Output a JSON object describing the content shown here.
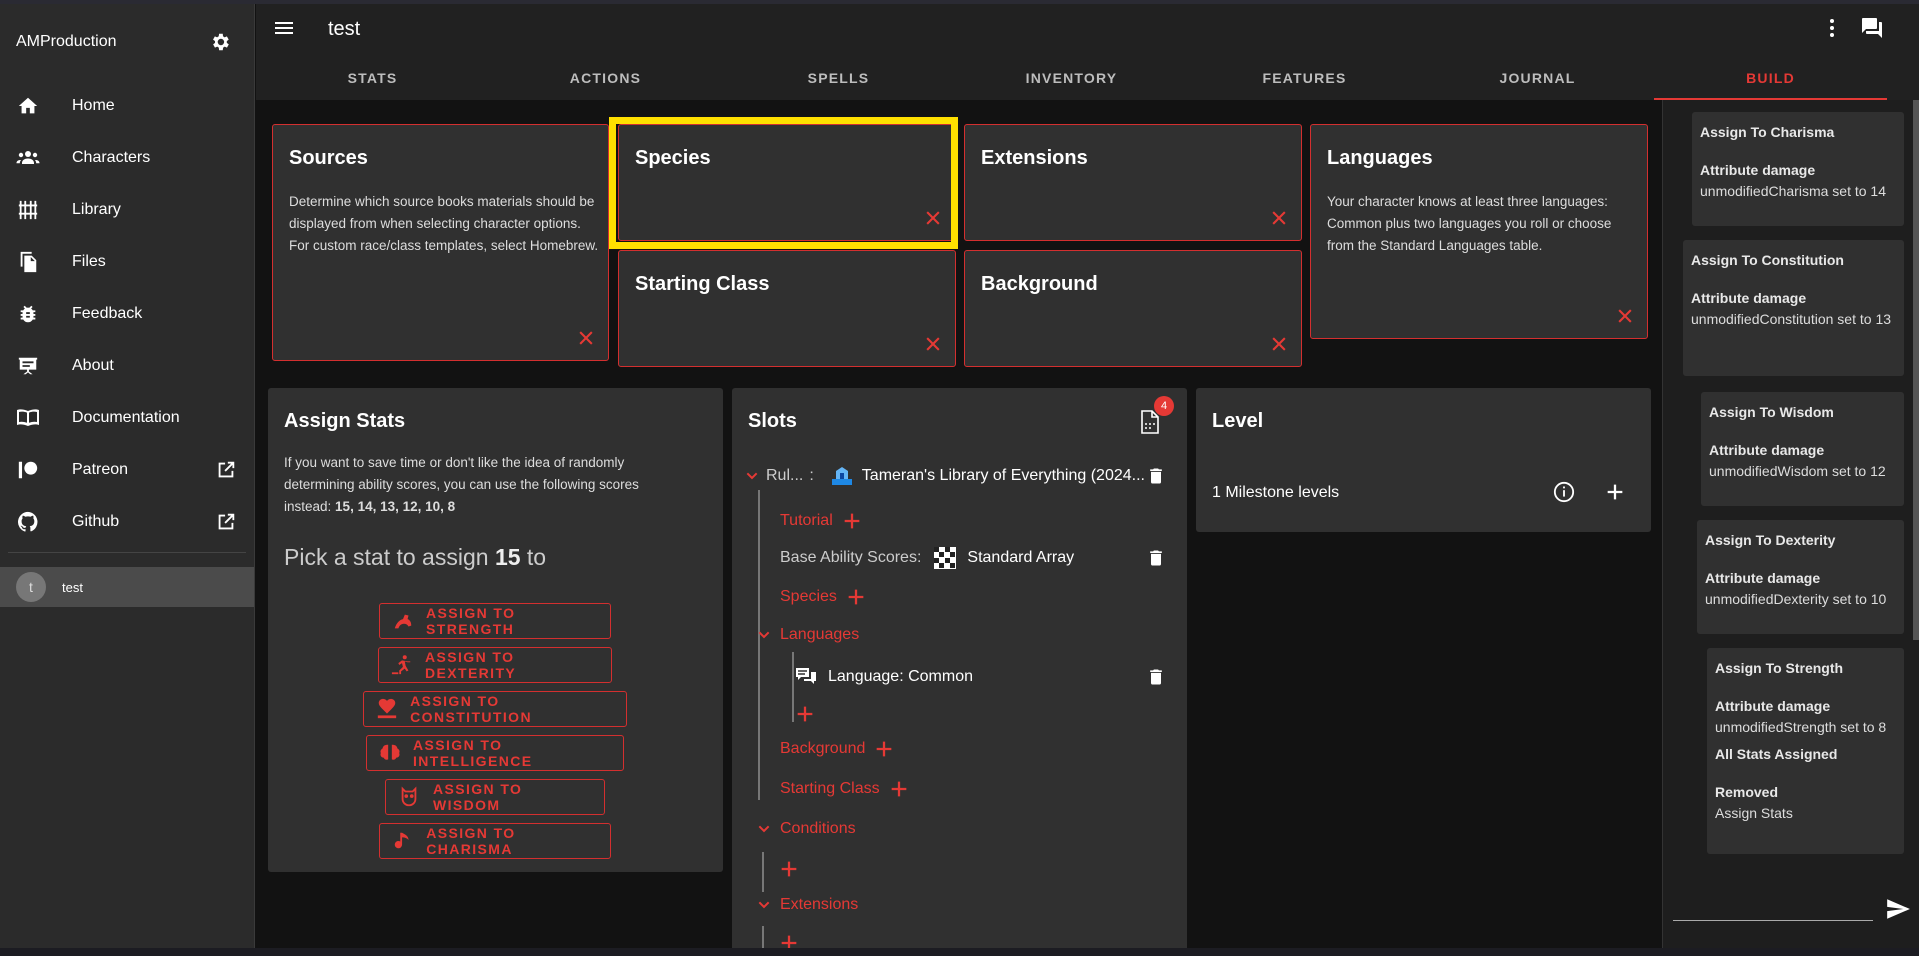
{
  "sidebar": {
    "title": "AMProduction",
    "items": [
      {
        "label": "Home",
        "icon": "home-icon"
      },
      {
        "label": "Characters",
        "icon": "people-icon"
      },
      {
        "label": "Library",
        "icon": "library-icon"
      },
      {
        "label": "Files",
        "icon": "files-icon"
      },
      {
        "label": "Feedback",
        "icon": "bug-icon"
      },
      {
        "label": "About",
        "icon": "presentation-icon"
      },
      {
        "label": "Documentation",
        "icon": "book-icon"
      },
      {
        "label": "Patreon",
        "icon": "patreon-icon"
      },
      {
        "label": "Github",
        "icon": "github-icon"
      }
    ],
    "character": {
      "avatar": "t",
      "name": "test"
    }
  },
  "appbar": {
    "title": "test",
    "tabs": [
      "STATS",
      "ACTIONS",
      "SPELLS",
      "INVENTORY",
      "FEATURES",
      "JOURNAL",
      "BUILD"
    ],
    "active_tab": "BUILD"
  },
  "cards": {
    "sources": {
      "title": "Sources",
      "desc": "Determine which source books materials should be displayed from when selecting character options. For custom race/class templates, select Homebrew."
    },
    "species": {
      "title": "Species"
    },
    "extensions": {
      "title": "Extensions"
    },
    "languages": {
      "title": "Languages",
      "desc": "Your character knows at least three languages: Common plus two languages you roll or choose from the Standard Languages table."
    },
    "starting_class": {
      "title": "Starting Class"
    },
    "background": {
      "title": "Background"
    }
  },
  "assign_stats": {
    "title": "Assign Stats",
    "desc_prefix": "If you want to save time or don't like the idea of randomly determining ability scores, you can use the following scores instead: ",
    "desc_scores": "15, 14, 13, 12, 10, 8",
    "pick_prefix": "Pick a stat to assign ",
    "pick_value": "15",
    "pick_suffix": " to",
    "buttons": [
      "ASSIGN TO STRENGTH",
      "ASSIGN TO DEXTERITY",
      "ASSIGN TO CONSTITUTION",
      "ASSIGN TO INTELLIGENCE",
      "ASSIGN TO WISDOM",
      "ASSIGN TO CHARISMA"
    ]
  },
  "slots": {
    "title": "Slots",
    "badge": "4",
    "ruleset_label": "Rul...",
    "ruleset_colon": ":",
    "ruleset_value": "Tameran's Library of Everything (2024...",
    "tutorial": "Tutorial",
    "base_ability_label": "Base Ability Scores:",
    "base_ability_value": "Standard Array",
    "species": "Species",
    "languages": "Languages",
    "language_item": "Language: Common",
    "background": "Background",
    "starting_class": "Starting Class",
    "conditions": "Conditions",
    "extensions": "Extensions"
  },
  "level": {
    "title": "Level",
    "milestone": "1 Milestone levels"
  },
  "feed": [
    {
      "title": "Assign To Charisma",
      "label": "Attribute damage",
      "value": "unmodifiedCharisma set to 14"
    },
    {
      "title": "Assign To Constitution",
      "label": "Attribute damage",
      "value": "unmodifiedConstitution set to 13"
    },
    {
      "title": "Assign To Wisdom",
      "label": "Attribute damage",
      "value": "unmodifiedWisdom set to 12"
    },
    {
      "title": "Assign To Dexterity",
      "label": "Attribute damage",
      "value": "unmodifiedDexterity set to 10"
    },
    {
      "title": "Assign To Strength",
      "label": "Attribute damage",
      "value": "unmodifiedStrength set to 8",
      "extra_title": "All Stats Assigned",
      "extra_label": "Removed",
      "extra_value": "Assign Stats"
    }
  ],
  "colors": {
    "accent": "#e53935",
    "highlight": "#ffe000",
    "card": "#303030"
  }
}
